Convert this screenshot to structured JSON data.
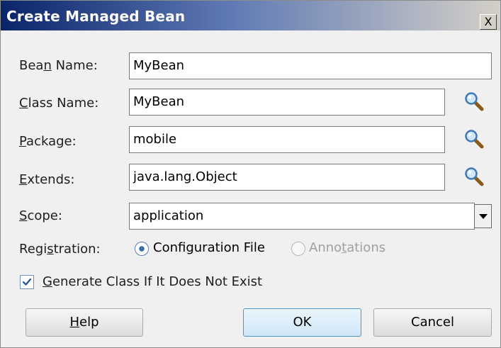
{
  "dialog": {
    "title": "Create Managed Bean",
    "close_glyph": "X"
  },
  "fields": {
    "bean_name": {
      "label": "Bean Name:",
      "value": "MyBean"
    },
    "class_name": {
      "label": "Class Name:",
      "value": "MyBean",
      "icon": "search-icon"
    },
    "package": {
      "label": "Package:",
      "value": "mobile",
      "icon": "search-icon"
    },
    "extends": {
      "label": "Extends:",
      "value": "java.lang.Object",
      "icon": "search-icon"
    },
    "scope": {
      "label": "Scope:",
      "value": "application"
    }
  },
  "registration": {
    "label": "Registration:",
    "options": [
      {
        "label": "Configuration File",
        "selected": true,
        "enabled": true
      },
      {
        "label": "Annotations",
        "selected": false,
        "enabled": false
      }
    ]
  },
  "generate": {
    "label": "Generate Class If It Does Not Exist",
    "checked": true
  },
  "buttons": {
    "help": "Help",
    "ok": "OK",
    "cancel": "Cancel"
  },
  "colors": {
    "title_start": "#0a246a",
    "title_end": "#d4d0c8",
    "accent": "#3a6ea5",
    "disabled_text": "#a0a0a0"
  }
}
